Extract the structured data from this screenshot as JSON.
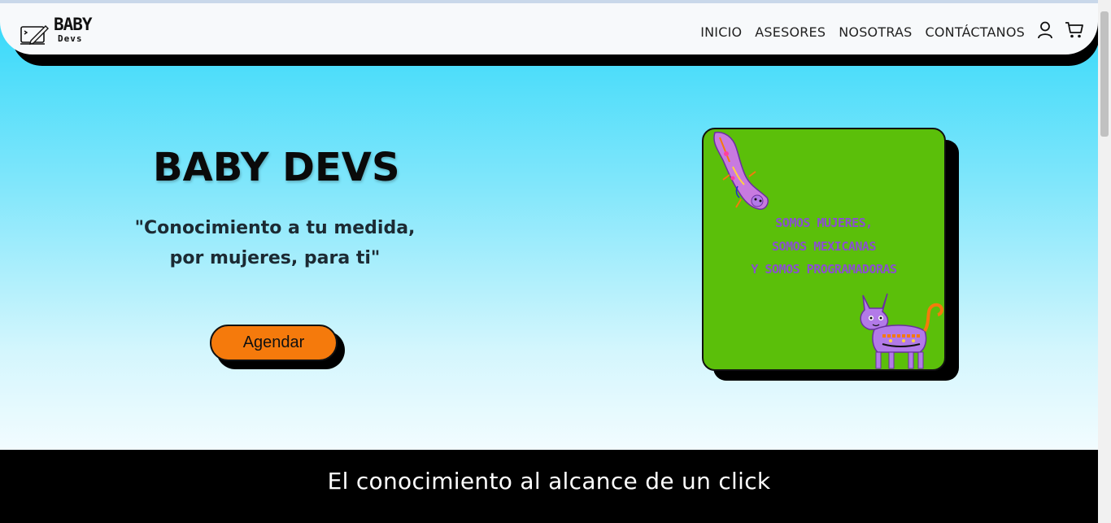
{
  "brand": {
    "line1": "BABY",
    "line2": "Devs"
  },
  "nav": {
    "links": [
      "INICIO",
      "ASESORES",
      "NOSOTRAS",
      "CONTÁCTANOS"
    ],
    "user_icon": "user-icon",
    "cart_icon": "cart-icon"
  },
  "hero": {
    "title": "BABY DEVS",
    "subtitle_line1": "\"Conocimiento a tu medida,",
    "subtitle_line2": "por mujeres, para ti\"",
    "cta_label": "Agendar"
  },
  "card": {
    "lines": [
      "SOMOS MUJERES,",
      "SOMOS MEXICANAS",
      "Y SOMOS PROGRAMADORAS"
    ],
    "background": "#5bbf0a",
    "text_color": "#8a4fd0"
  },
  "banner": {
    "text": "El conocimiento al alcance de un click"
  },
  "colors": {
    "accent": "#f57a0c",
    "hero_top": "#31d8fa",
    "nav_bg": "#f7f9fb"
  }
}
